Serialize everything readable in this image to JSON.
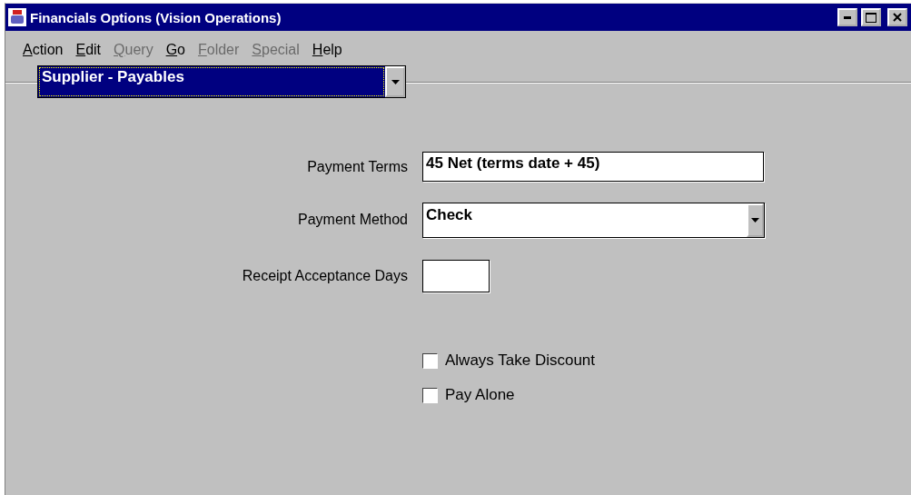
{
  "window": {
    "title": "Financials Options (Vision Operations)"
  },
  "menu": [
    {
      "label": "Action",
      "disabled": false
    },
    {
      "label": "Edit",
      "disabled": false
    },
    {
      "label": "Query",
      "disabled": true
    },
    {
      "label": "Go",
      "disabled": false
    },
    {
      "label": "Folder",
      "disabled": true
    },
    {
      "label": "Special",
      "disabled": true
    },
    {
      "label": "Help",
      "disabled": false
    }
  ],
  "region": {
    "value": "Supplier - Payables"
  },
  "fields": [
    {
      "kind": "text",
      "label": "Payment Terms",
      "value": "45 Net (terms date + 45)"
    },
    {
      "kind": "select",
      "label": "Payment Method",
      "value": "Check"
    },
    {
      "kind": "short",
      "label": "Receipt Acceptance Days"
    }
  ],
  "checkboxes": [
    {
      "label": "Always Take Discount",
      "checked": false
    },
    {
      "label": "Pay Alone",
      "checked": false
    }
  ]
}
